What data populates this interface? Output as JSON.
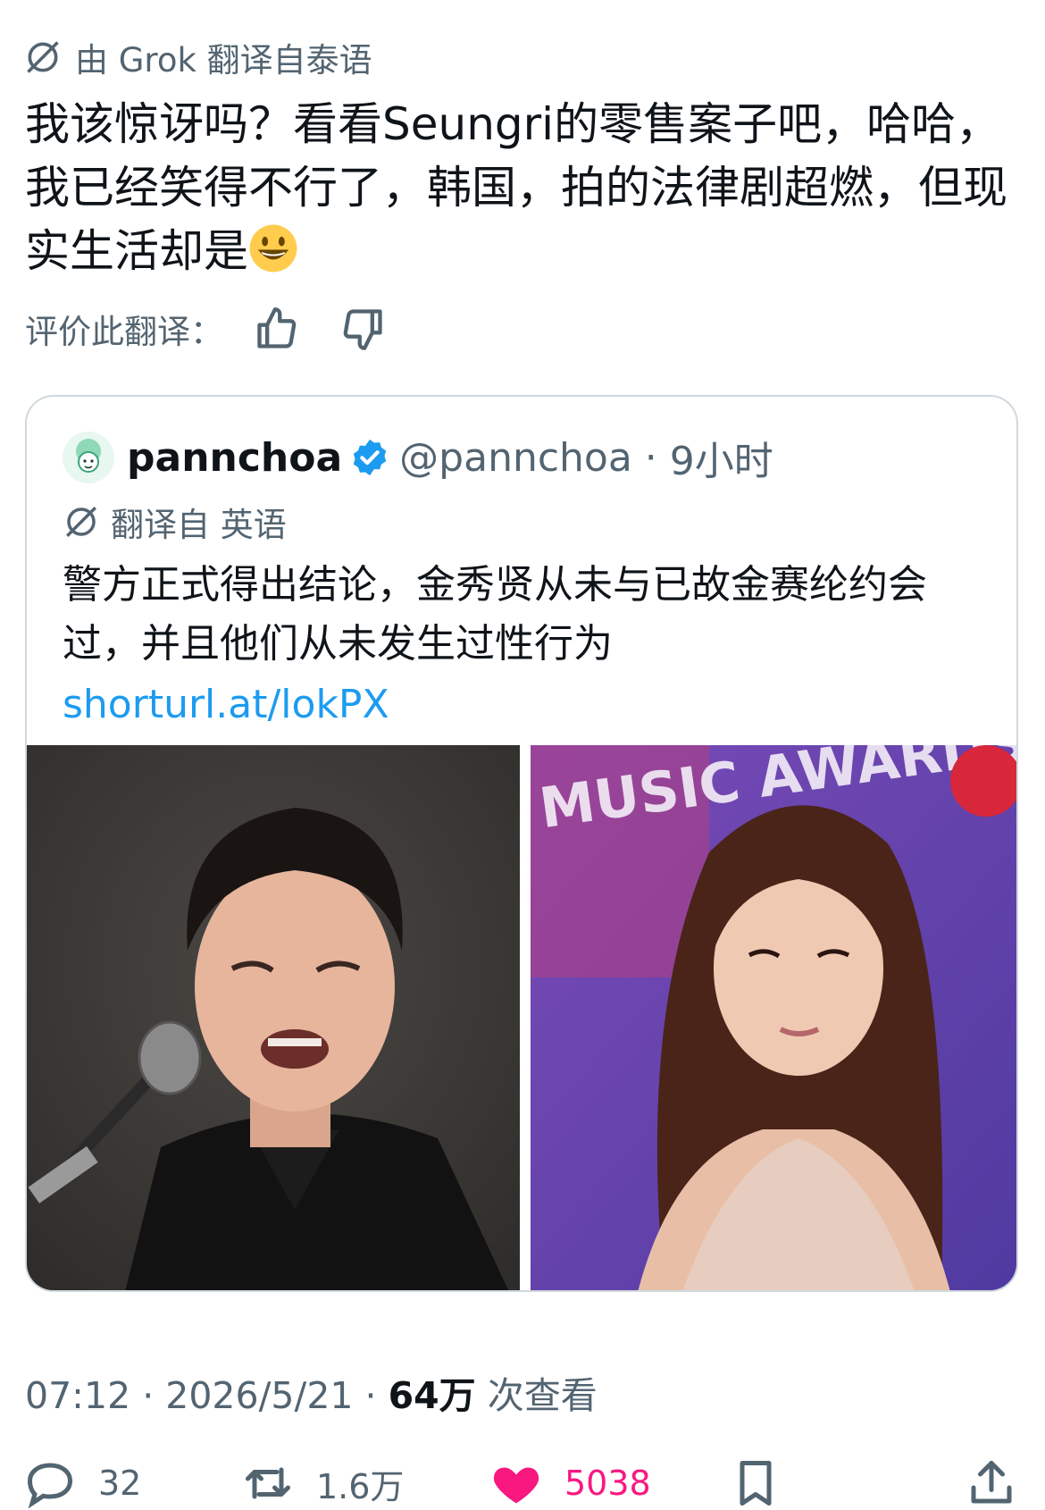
{
  "translation_header": {
    "icon": "translate-icon",
    "label": "由 Grok 翻译自泰语"
  },
  "tweet": {
    "text_before_emoji": "我该惊讶吗？看看Seungri的零售案子吧，哈哈，我已经笑得不行了，韩国，拍的法律剧超燃，但现实生活却是",
    "emoji": "grinning-face"
  },
  "rate": {
    "label": "评价此翻译：",
    "up_icon": "thumbs-up-icon",
    "down_icon": "thumbs-down-icon"
  },
  "quote": {
    "name": "pannchoa",
    "handle": "@pannchoa",
    "time": "9小时",
    "translation_label": "翻译自 英语",
    "text": "警方正式得出结论，金秀贤从未与已故金赛纶约会过，并且他们从未发生过性行为",
    "link": "shorturl.at/lokPX",
    "media_right_sign_text": "MUSIC AWARDS"
  },
  "meta": {
    "time": "07:12",
    "date": "2026/5/21",
    "views_count": "64万",
    "views_label": "次查看"
  },
  "actions": {
    "replies": "32",
    "retweets": "1.6万",
    "likes": "5038"
  },
  "colors": {
    "accent": "#1d9bf0",
    "like": "#f91880",
    "text": "#0f1419",
    "muted": "#536471",
    "border": "#cfd9de"
  }
}
